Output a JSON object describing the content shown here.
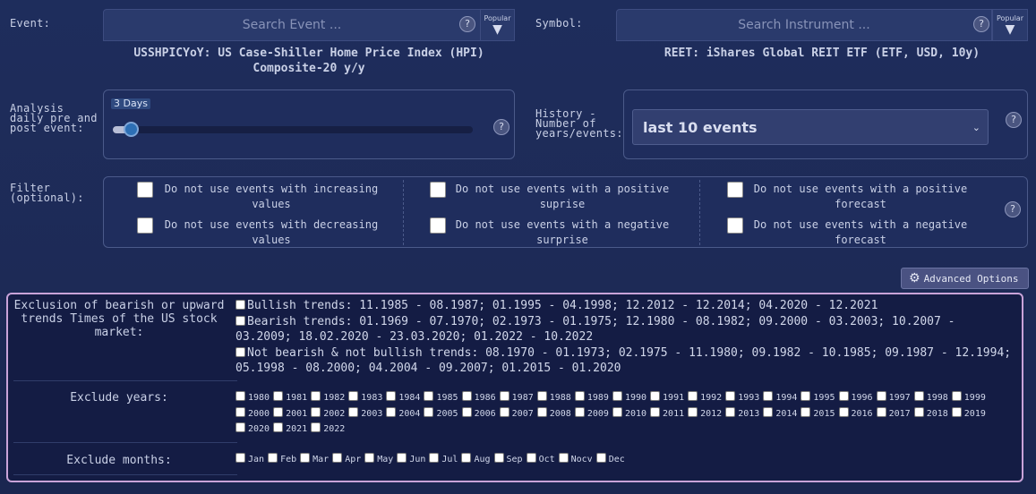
{
  "event": {
    "label": "Event:",
    "search_placeholder": "Search Event ...",
    "help": "?",
    "popular_label": "Popular",
    "popular_arrow": "▼",
    "selected": "USSHPICYoY: US Case-Shiller Home Price Index (HPI) Composite-20 y/y"
  },
  "symbol": {
    "label": "Symbol:",
    "search_placeholder": "Search Instrument ...",
    "help": "?",
    "popular_label": "Popular",
    "popular_arrow": "▼",
    "selected": "REET: iShares Global REIT ETF (ETF, USD, 10y)"
  },
  "analysis": {
    "label": "Analysis daily pre and post event:",
    "slider_badge": "3 Days",
    "slider_value_fraction": 0.04,
    "help": "?"
  },
  "history": {
    "label": "History - Number of years/events:",
    "selected": "last 10 events",
    "help": "?"
  },
  "filter": {
    "label": "Filter (optional):",
    "help": "?",
    "options": [
      "Do not use events with increasing values",
      "Do not use events with decreasing values",
      "Do not use events with a positive suprise",
      "Do not use events with a negative surprise",
      "Do not use events with a positive forecast",
      "Do not use events with a negative forecast"
    ]
  },
  "advanced": {
    "button_label": "Advanced Options ▲",
    "gear_glyph": "⚙"
  },
  "exclusion": {
    "label": "Exclusion of bearish or upward trends Times of the US stock market:",
    "bullish": "Bullish trends: 11.1985 - 08.1987; 01.1995 - 04.1998; 12.2012 - 12.2014; 04.2020 - 12.2021",
    "bearish": "Bearish trends: 01.1969 - 07.1970; 02.1973 - 01.1975; 12.1980 - 08.1982; 09.2000 - 03.2003; 10.2007 - 03.2009; 18.02.2020 - 23.03.2020; 01.2022 - 10.2022",
    "neither": "Not bearish & not bullish trends: 08.1970 - 01.1973; 02.1975 - 11.1980; 09.1982 - 10.1985; 09.1987 - 12.1994; 05.1998 - 08.2000; 04.2004 - 09.2007; 01.2015 - 01.2020"
  },
  "exclude_years": {
    "label": "Exclude years:",
    "years": [
      "1980",
      "1981",
      "1982",
      "1983",
      "1984",
      "1985",
      "1986",
      "1987",
      "1988",
      "1989",
      "1990",
      "1991",
      "1992",
      "1993",
      "1994",
      "1995",
      "1996",
      "1997",
      "1998",
      "1999",
      "2000",
      "2001",
      "2002",
      "2003",
      "2004",
      "2005",
      "2006",
      "2007",
      "2008",
      "2009",
      "2010",
      "2011",
      "2012",
      "2013",
      "2014",
      "2015",
      "2016",
      "2017",
      "2018",
      "2019",
      "2020",
      "2021",
      "2022"
    ]
  },
  "exclude_months": {
    "label": "Exclude months:",
    "months": [
      "Jan",
      "Feb",
      "Mar",
      "Apr",
      "May",
      "Jun",
      "Jul",
      "Aug",
      "Sep",
      "Oct",
      "Nocv",
      "Dec"
    ]
  }
}
